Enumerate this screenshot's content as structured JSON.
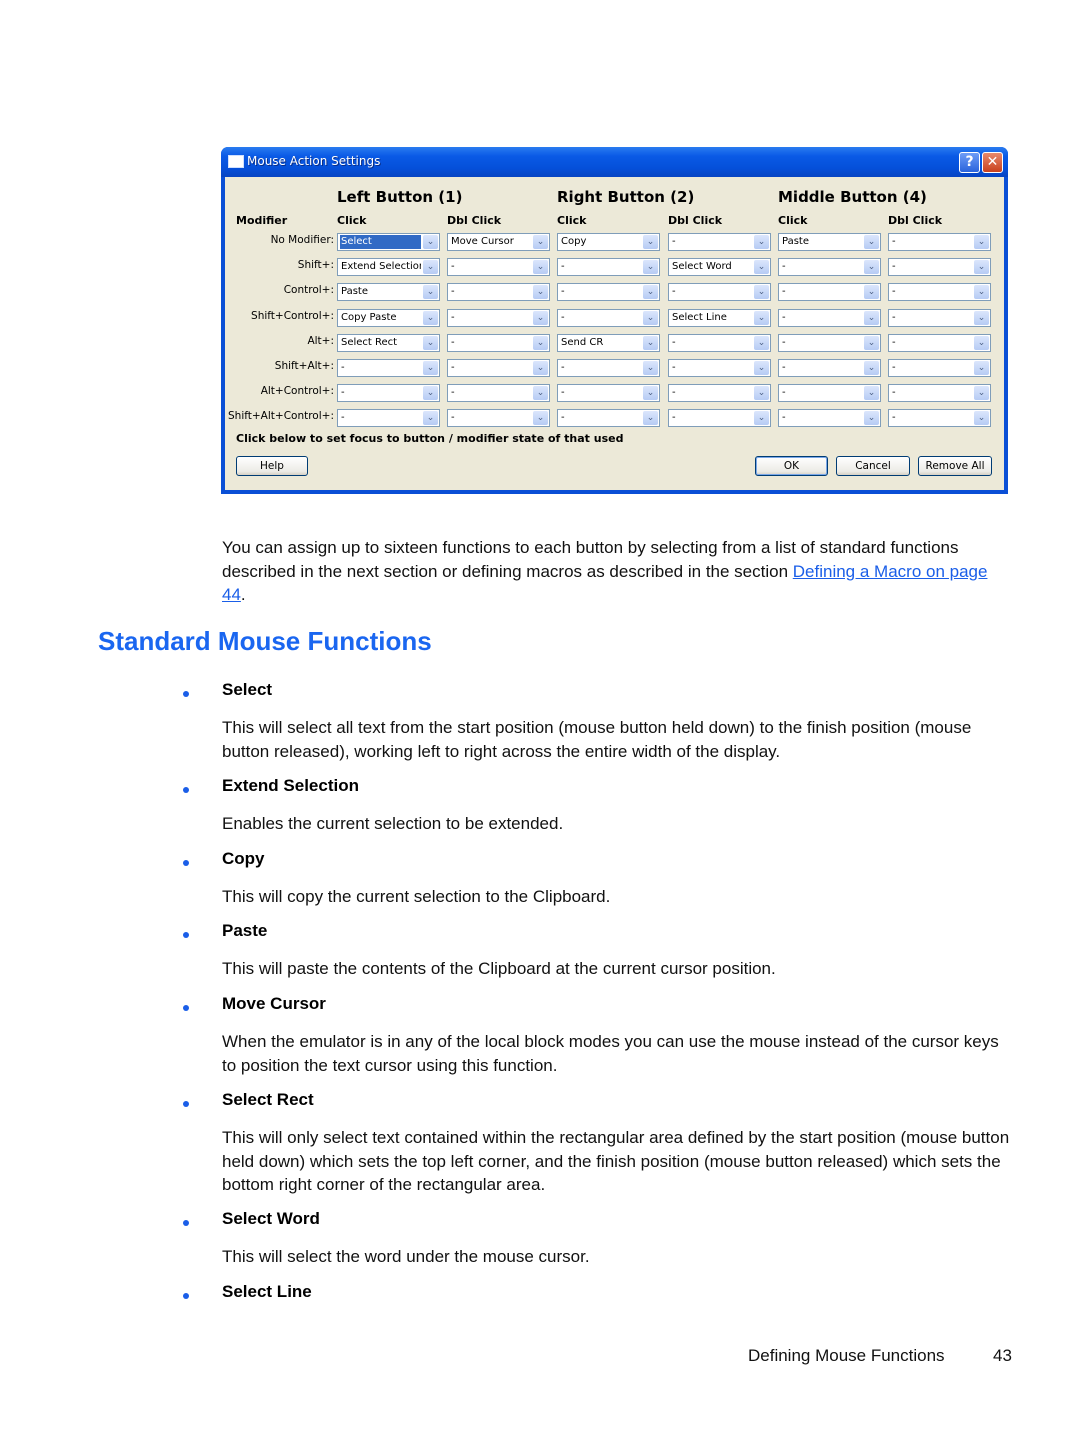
{
  "dialog": {
    "title": "Mouse Action Settings",
    "help_glyph": "?",
    "close_glyph": "✕",
    "modifier_header": "Modifier",
    "groups": [
      "Left Button (1)",
      "Right Button (2)",
      "Middle Button (4)"
    ],
    "column_headers": [
      "Click",
      "Dbl Click",
      "Click",
      "Dbl Click",
      "Click",
      "Dbl Click"
    ],
    "dropdown_glyph": "⌄",
    "rows": [
      {
        "modifier": "No Modifier:",
        "values": [
          "Select",
          "Move Cursor",
          "Copy",
          "-",
          "Paste",
          "-"
        ]
      },
      {
        "modifier": "Shift+:",
        "values": [
          "Extend Selection",
          "-",
          "-",
          "Select Word",
          "-",
          "-"
        ]
      },
      {
        "modifier": "Control+:",
        "values": [
          "Paste",
          "-",
          "-",
          "-",
          "-",
          "-"
        ]
      },
      {
        "modifier": "Shift+Control+:",
        "values": [
          "Copy Paste",
          "-",
          "-",
          "Select Line",
          "-",
          "-"
        ]
      },
      {
        "modifier": "Alt+:",
        "values": [
          "Select Rect",
          "-",
          "Send CR",
          "-",
          "-",
          "-"
        ]
      },
      {
        "modifier": "Shift+Alt+:",
        "values": [
          "-",
          "-",
          "-",
          "-",
          "-",
          "-"
        ]
      },
      {
        "modifier": "Alt+Control+:",
        "values": [
          "-",
          "-",
          "-",
          "-",
          "-",
          "-"
        ]
      },
      {
        "modifier": "Shift+Alt+Control+:",
        "values": [
          "-",
          "-",
          "-",
          "-",
          "-",
          "-"
        ]
      }
    ],
    "hint": "Click below to set focus to button / modifier state of that used",
    "buttons": {
      "help": "Help",
      "ok": "OK",
      "cancel": "Cancel",
      "remove_all": "Remove All"
    }
  },
  "intro": {
    "text_before": "You can assign up to sixteen functions to each button by selecting from a list of standard functions described in the next section or defining macros as described in the section ",
    "link_text": "Defining a Macro on page 44",
    "text_after": "."
  },
  "section_title": "Standard Mouse Functions",
  "functions": [
    {
      "term": "Select",
      "description": "This will select all text from the start position (mouse button held down) to the finish position (mouse button released), working left to right across the entire width of the display."
    },
    {
      "term": "Extend Selection",
      "description": "Enables the current selection to be extended."
    },
    {
      "term": "Copy",
      "description": "This will copy the current selection to the Clipboard."
    },
    {
      "term": "Paste",
      "description": "This will paste the contents of the Clipboard at the current cursor position."
    },
    {
      "term": "Move Cursor",
      "description": "When the emulator is in any of the local block modes you can use the mouse instead of the cursor keys to position the text cursor using this function."
    },
    {
      "term": "Select Rect",
      "description": "This will only select text contained within the rectangular area defined by the start position (mouse button held down) which sets the top left corner, and the finish position (mouse button released) which sets the bottom right corner of the rectangular area."
    },
    {
      "term": "Select Word",
      "description": "This will select the word under the mouse cursor."
    },
    {
      "term": "Select Line",
      "description": ""
    }
  ],
  "footer": {
    "section": "Defining Mouse Functions",
    "page": "43"
  },
  "colors": {
    "accent": "#1a66f0",
    "link": "#1a5ee8",
    "selection": "#316ac5",
    "dialog_bg": "#ece9d8"
  }
}
